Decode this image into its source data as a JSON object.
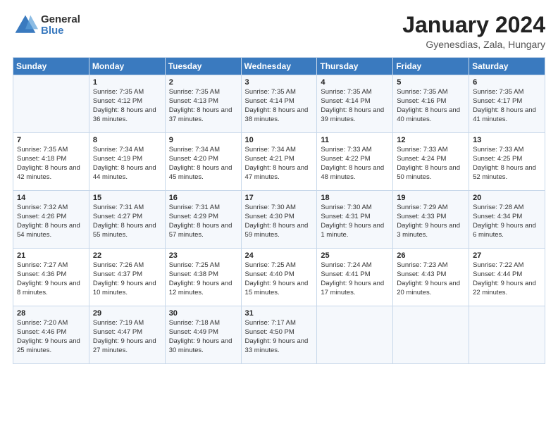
{
  "header": {
    "logo_general": "General",
    "logo_blue": "Blue",
    "month_title": "January 2024",
    "location": "Gyenesdias, Zala, Hungary"
  },
  "days_of_week": [
    "Sunday",
    "Monday",
    "Tuesday",
    "Wednesday",
    "Thursday",
    "Friday",
    "Saturday"
  ],
  "weeks": [
    [
      {
        "day": "",
        "sunrise": "",
        "sunset": "",
        "daylight": ""
      },
      {
        "day": "1",
        "sunrise": "Sunrise: 7:35 AM",
        "sunset": "Sunset: 4:12 PM",
        "daylight": "Daylight: 8 hours and 36 minutes."
      },
      {
        "day": "2",
        "sunrise": "Sunrise: 7:35 AM",
        "sunset": "Sunset: 4:13 PM",
        "daylight": "Daylight: 8 hours and 37 minutes."
      },
      {
        "day": "3",
        "sunrise": "Sunrise: 7:35 AM",
        "sunset": "Sunset: 4:14 PM",
        "daylight": "Daylight: 8 hours and 38 minutes."
      },
      {
        "day": "4",
        "sunrise": "Sunrise: 7:35 AM",
        "sunset": "Sunset: 4:14 PM",
        "daylight": "Daylight: 8 hours and 39 minutes."
      },
      {
        "day": "5",
        "sunrise": "Sunrise: 7:35 AM",
        "sunset": "Sunset: 4:16 PM",
        "daylight": "Daylight: 8 hours and 40 minutes."
      },
      {
        "day": "6",
        "sunrise": "Sunrise: 7:35 AM",
        "sunset": "Sunset: 4:17 PM",
        "daylight": "Daylight: 8 hours and 41 minutes."
      }
    ],
    [
      {
        "day": "7",
        "sunrise": "Sunrise: 7:35 AM",
        "sunset": "Sunset: 4:18 PM",
        "daylight": "Daylight: 8 hours and 42 minutes."
      },
      {
        "day": "8",
        "sunrise": "Sunrise: 7:34 AM",
        "sunset": "Sunset: 4:19 PM",
        "daylight": "Daylight: 8 hours and 44 minutes."
      },
      {
        "day": "9",
        "sunrise": "Sunrise: 7:34 AM",
        "sunset": "Sunset: 4:20 PM",
        "daylight": "Daylight: 8 hours and 45 minutes."
      },
      {
        "day": "10",
        "sunrise": "Sunrise: 7:34 AM",
        "sunset": "Sunset: 4:21 PM",
        "daylight": "Daylight: 8 hours and 47 minutes."
      },
      {
        "day": "11",
        "sunrise": "Sunrise: 7:33 AM",
        "sunset": "Sunset: 4:22 PM",
        "daylight": "Daylight: 8 hours and 48 minutes."
      },
      {
        "day": "12",
        "sunrise": "Sunrise: 7:33 AM",
        "sunset": "Sunset: 4:24 PM",
        "daylight": "Daylight: 8 hours and 50 minutes."
      },
      {
        "day": "13",
        "sunrise": "Sunrise: 7:33 AM",
        "sunset": "Sunset: 4:25 PM",
        "daylight": "Daylight: 8 hours and 52 minutes."
      }
    ],
    [
      {
        "day": "14",
        "sunrise": "Sunrise: 7:32 AM",
        "sunset": "Sunset: 4:26 PM",
        "daylight": "Daylight: 8 hours and 54 minutes."
      },
      {
        "day": "15",
        "sunrise": "Sunrise: 7:31 AM",
        "sunset": "Sunset: 4:27 PM",
        "daylight": "Daylight: 8 hours and 55 minutes."
      },
      {
        "day": "16",
        "sunrise": "Sunrise: 7:31 AM",
        "sunset": "Sunset: 4:29 PM",
        "daylight": "Daylight: 8 hours and 57 minutes."
      },
      {
        "day": "17",
        "sunrise": "Sunrise: 7:30 AM",
        "sunset": "Sunset: 4:30 PM",
        "daylight": "Daylight: 8 hours and 59 minutes."
      },
      {
        "day": "18",
        "sunrise": "Sunrise: 7:30 AM",
        "sunset": "Sunset: 4:31 PM",
        "daylight": "Daylight: 9 hours and 1 minute."
      },
      {
        "day": "19",
        "sunrise": "Sunrise: 7:29 AM",
        "sunset": "Sunset: 4:33 PM",
        "daylight": "Daylight: 9 hours and 3 minutes."
      },
      {
        "day": "20",
        "sunrise": "Sunrise: 7:28 AM",
        "sunset": "Sunset: 4:34 PM",
        "daylight": "Daylight: 9 hours and 6 minutes."
      }
    ],
    [
      {
        "day": "21",
        "sunrise": "Sunrise: 7:27 AM",
        "sunset": "Sunset: 4:36 PM",
        "daylight": "Daylight: 9 hours and 8 minutes."
      },
      {
        "day": "22",
        "sunrise": "Sunrise: 7:26 AM",
        "sunset": "Sunset: 4:37 PM",
        "daylight": "Daylight: 9 hours and 10 minutes."
      },
      {
        "day": "23",
        "sunrise": "Sunrise: 7:25 AM",
        "sunset": "Sunset: 4:38 PM",
        "daylight": "Daylight: 9 hours and 12 minutes."
      },
      {
        "day": "24",
        "sunrise": "Sunrise: 7:25 AM",
        "sunset": "Sunset: 4:40 PM",
        "daylight": "Daylight: 9 hours and 15 minutes."
      },
      {
        "day": "25",
        "sunrise": "Sunrise: 7:24 AM",
        "sunset": "Sunset: 4:41 PM",
        "daylight": "Daylight: 9 hours and 17 minutes."
      },
      {
        "day": "26",
        "sunrise": "Sunrise: 7:23 AM",
        "sunset": "Sunset: 4:43 PM",
        "daylight": "Daylight: 9 hours and 20 minutes."
      },
      {
        "day": "27",
        "sunrise": "Sunrise: 7:22 AM",
        "sunset": "Sunset: 4:44 PM",
        "daylight": "Daylight: 9 hours and 22 minutes."
      }
    ],
    [
      {
        "day": "28",
        "sunrise": "Sunrise: 7:20 AM",
        "sunset": "Sunset: 4:46 PM",
        "daylight": "Daylight: 9 hours and 25 minutes."
      },
      {
        "day": "29",
        "sunrise": "Sunrise: 7:19 AM",
        "sunset": "Sunset: 4:47 PM",
        "daylight": "Daylight: 9 hours and 27 minutes."
      },
      {
        "day": "30",
        "sunrise": "Sunrise: 7:18 AM",
        "sunset": "Sunset: 4:49 PM",
        "daylight": "Daylight: 9 hours and 30 minutes."
      },
      {
        "day": "31",
        "sunrise": "Sunrise: 7:17 AM",
        "sunset": "Sunset: 4:50 PM",
        "daylight": "Daylight: 9 hours and 33 minutes."
      },
      {
        "day": "",
        "sunrise": "",
        "sunset": "",
        "daylight": ""
      },
      {
        "day": "",
        "sunrise": "",
        "sunset": "",
        "daylight": ""
      },
      {
        "day": "",
        "sunrise": "",
        "sunset": "",
        "daylight": ""
      }
    ]
  ]
}
